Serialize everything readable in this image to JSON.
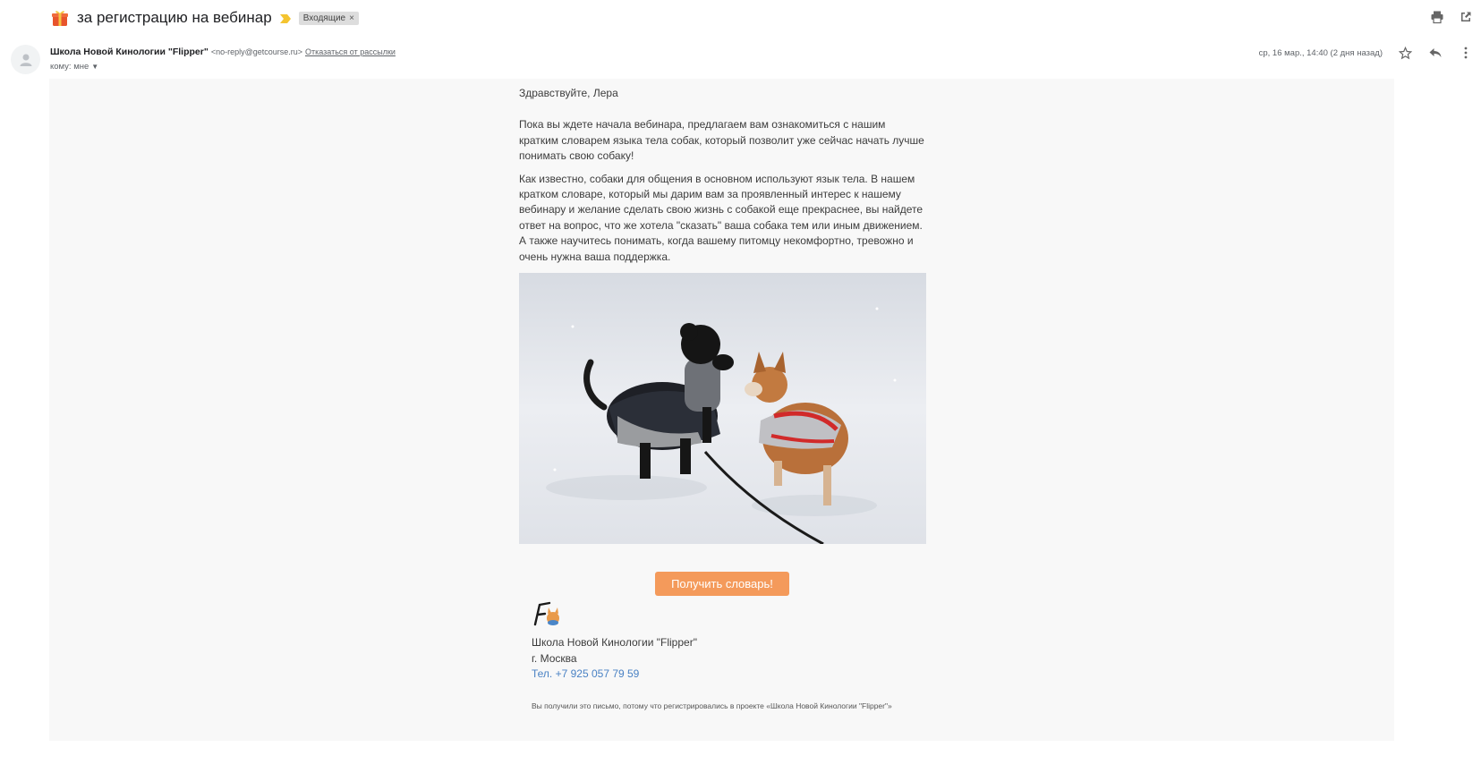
{
  "subject": {
    "title": "за регистрацию на вебинар",
    "label": "Входящие",
    "label_remove": "×"
  },
  "sender": {
    "name": "Школа Новой Кинологии \"Flipper\"",
    "email": "<no-reply@getcourse.ru>",
    "unsubscribe": "Отказаться от рассылки",
    "to_label": "кому: мне",
    "date": "ср, 16 мар., 14:40 (2 дня назад)"
  },
  "body": {
    "greeting": "Здравствуйте, Лера",
    "para1": "Пока вы ждете начала вебинара, предлагаем вам ознакомиться с нашим кратким словарем языка тела собак, который позволит уже сейчас начать лучше понимать свою собаку!",
    "para2": "Как известно, собаки для общения в основном используют язык тела. В нашем кратком словаре, который мы дарим вам за проявленный интерес к нашему вебинару и желание сделать свою жизнь с собакой еще прекраснее, вы найдете ответ на вопрос, что же хотела \"сказать\" ваша собака тем или иным движением. А также научитесь понимать, когда вашему питомцу некомфортно, тревожно и очень нужна ваша поддержка.",
    "cta": "Получить словарь!"
  },
  "footer": {
    "org": "Школа Новой Кинологии \"Flipper\"",
    "city": "г. Москва",
    "phone": "Тел. +7 925 057 79 59",
    "disclaimer": "Вы получили это письмо, потому что регистрировались в проекте «Школа Новой Кинологии \"Flipper\"»"
  },
  "colors": {
    "cta": "#f49a5b",
    "link": "#4a82c4",
    "email_bg": "#f8f8f8"
  },
  "icons": [
    "gift-icon",
    "importance-icon",
    "print-icon",
    "open-new-window-icon",
    "avatar-icon",
    "star-icon",
    "reply-icon",
    "more-icon",
    "caret-down-icon"
  ]
}
